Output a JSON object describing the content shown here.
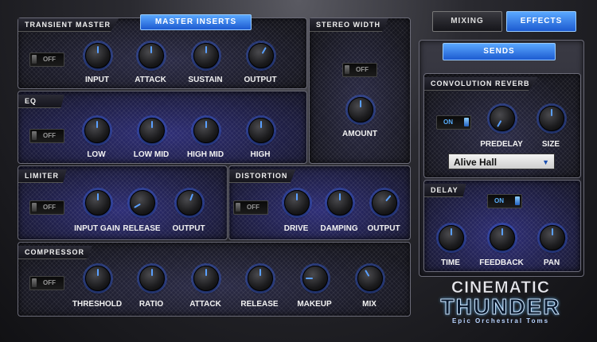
{
  "tabs": {
    "mixing": "MIXING",
    "effects": "EFFECTS"
  },
  "master_inserts": "MASTER INSERTS",
  "sends": "SENDS",
  "transient_master": {
    "title": "TRANSIENT MASTER",
    "toggle": "OFF",
    "knobs": [
      "INPUT",
      "ATTACK",
      "SUSTAIN",
      "OUTPUT"
    ]
  },
  "stereo_width": {
    "title": "STEREO WIDTH",
    "toggle": "OFF",
    "knob": "AMOUNT"
  },
  "eq": {
    "title": "EQ",
    "toggle": "OFF",
    "knobs": [
      "LOW",
      "LOW MID",
      "HIGH MID",
      "HIGH"
    ]
  },
  "limiter": {
    "title": "LIMITER",
    "toggle": "OFF",
    "knobs": [
      "INPUT GAIN",
      "RELEASE",
      "OUTPUT"
    ]
  },
  "distortion": {
    "title": "DISTORTION",
    "toggle": "OFF",
    "knobs": [
      "DRIVE",
      "DAMPING",
      "OUTPUT"
    ]
  },
  "compressor": {
    "title": "COMPRESSOR",
    "toggle": "OFF",
    "knobs": [
      "THRESHOLD",
      "RATIO",
      "ATTACK",
      "RELEASE",
      "MAKEUP",
      "MIX"
    ]
  },
  "convolution": {
    "title": "CONVOLUTION REVERB",
    "toggle": "ON",
    "knobs": [
      "PREDELAY",
      "SIZE"
    ],
    "preset": "Alive Hall"
  },
  "delay": {
    "title": "DELAY",
    "toggle": "ON",
    "knobs": [
      "TIME",
      "FEEDBACK",
      "PAN"
    ]
  },
  "logo": {
    "line1": "CINEMATIC",
    "line2": "THUNDER",
    "tagline": "Epic Orchestral Toms"
  },
  "colors": {
    "accent": "#3a8cff",
    "active_tab": "#2f7bef",
    "panel_blue": "#2f2f78"
  }
}
